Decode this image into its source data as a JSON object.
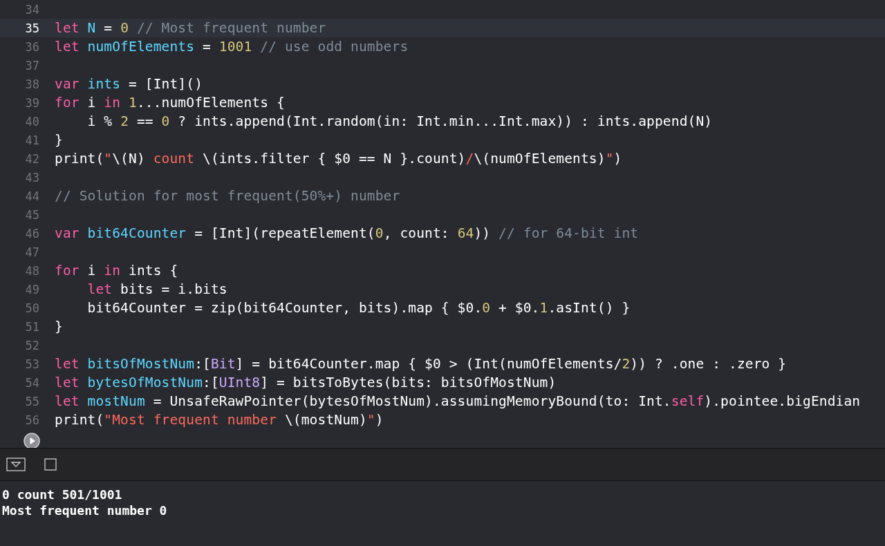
{
  "editor": {
    "lines": [
      {
        "number": "34",
        "selected": false
      },
      {
        "number": "35",
        "selected": true,
        "tokens": [
          {
            "kind": "kw",
            "text": "let "
          },
          {
            "kind": "ident",
            "text": "N"
          },
          {
            "kind": "plain",
            "text": " = "
          },
          {
            "kind": "num",
            "text": "0"
          },
          {
            "kind": "comment",
            "text": " // Most frequent number"
          }
        ]
      },
      {
        "number": "36",
        "selected": false,
        "tokens": [
          {
            "kind": "kw",
            "text": "let "
          },
          {
            "kind": "ident",
            "text": "numOfElements"
          },
          {
            "kind": "plain",
            "text": " = "
          },
          {
            "kind": "num",
            "text": "1001"
          },
          {
            "kind": "comment",
            "text": " // use odd numbers"
          }
        ]
      },
      {
        "number": "37",
        "selected": false
      },
      {
        "number": "38",
        "selected": false,
        "tokens": [
          {
            "kind": "kw",
            "text": "var "
          },
          {
            "kind": "ident",
            "text": "ints"
          },
          {
            "kind": "plain",
            "text": " = [Int]()"
          }
        ]
      },
      {
        "number": "39",
        "selected": false,
        "tokens": [
          {
            "kind": "kw",
            "text": "for"
          },
          {
            "kind": "plain",
            "text": " i "
          },
          {
            "kind": "kw",
            "text": "in "
          },
          {
            "kind": "num",
            "text": "1"
          },
          {
            "kind": "plain",
            "text": "...numOfElements {"
          }
        ]
      },
      {
        "number": "40",
        "selected": false,
        "tokens": [
          {
            "kind": "plain",
            "text": "    i % "
          },
          {
            "kind": "num",
            "text": "2"
          },
          {
            "kind": "plain",
            "text": " == "
          },
          {
            "kind": "num",
            "text": "0"
          },
          {
            "kind": "plain",
            "text": " ? ints.append(Int.random(in: Int.min...Int.max)) : ints.append(N)"
          }
        ]
      },
      {
        "number": "41",
        "selected": false,
        "tokens": [
          {
            "kind": "plain",
            "text": "}"
          }
        ]
      },
      {
        "number": "42",
        "selected": false,
        "tokens": [
          {
            "kind": "plain",
            "text": "print("
          },
          {
            "kind": "str",
            "text": "\""
          },
          {
            "kind": "plain",
            "text": "\\(N)"
          },
          {
            "kind": "str",
            "text": " count "
          },
          {
            "kind": "plain",
            "text": "\\(ints.filter { $0 == N }.count)"
          },
          {
            "kind": "str",
            "text": "/"
          },
          {
            "kind": "plain",
            "text": "\\(numOfElements)"
          },
          {
            "kind": "str",
            "text": "\""
          },
          {
            "kind": "plain",
            "text": ")"
          }
        ]
      },
      {
        "number": "43",
        "selected": false
      },
      {
        "number": "44",
        "selected": false,
        "tokens": [
          {
            "kind": "comment",
            "text": "// Solution for most frequent(50%+) number"
          }
        ]
      },
      {
        "number": "45",
        "selected": false
      },
      {
        "number": "46",
        "selected": false,
        "tokens": [
          {
            "kind": "kw",
            "text": "var "
          },
          {
            "kind": "ident",
            "text": "bit64Counter"
          },
          {
            "kind": "plain",
            "text": " = [Int](repeatElement("
          },
          {
            "kind": "num",
            "text": "0"
          },
          {
            "kind": "plain",
            "text": ", count: "
          },
          {
            "kind": "num",
            "text": "64"
          },
          {
            "kind": "plain",
            "text": ")) "
          },
          {
            "kind": "comment",
            "text": "// for 64-bit int"
          }
        ]
      },
      {
        "number": "47",
        "selected": false
      },
      {
        "number": "48",
        "selected": false,
        "tokens": [
          {
            "kind": "kw",
            "text": "for"
          },
          {
            "kind": "plain",
            "text": " i "
          },
          {
            "kind": "kw",
            "text": "in"
          },
          {
            "kind": "plain",
            "text": " ints {"
          }
        ]
      },
      {
        "number": "49",
        "selected": false,
        "tokens": [
          {
            "kind": "kw",
            "text": "    let"
          },
          {
            "kind": "plain",
            "text": " bits = i.bits"
          }
        ]
      },
      {
        "number": "50",
        "selected": false,
        "tokens": [
          {
            "kind": "plain",
            "text": "    bit64Counter = zip(bit64Counter, bits).map { $0."
          },
          {
            "kind": "num",
            "text": "0"
          },
          {
            "kind": "plain",
            "text": " + $0."
          },
          {
            "kind": "num",
            "text": "1"
          },
          {
            "kind": "plain",
            "text": ".asInt() }"
          }
        ]
      },
      {
        "number": "51",
        "selected": false,
        "tokens": [
          {
            "kind": "plain",
            "text": "}"
          }
        ]
      },
      {
        "number": "52",
        "selected": false
      },
      {
        "number": "53",
        "selected": false,
        "tokens": [
          {
            "kind": "kw",
            "text": "let "
          },
          {
            "kind": "ident",
            "text": "bitsOfMostNum"
          },
          {
            "kind": "plain",
            "text": ":["
          },
          {
            "kind": "type",
            "text": "Bit"
          },
          {
            "kind": "plain",
            "text": "] = bit64Counter.map { $0 > (Int(numOfElements/"
          },
          {
            "kind": "num",
            "text": "2"
          },
          {
            "kind": "plain",
            "text": ")) ? .one : .zero }"
          }
        ]
      },
      {
        "number": "54",
        "selected": false,
        "tokens": [
          {
            "kind": "kw",
            "text": "let "
          },
          {
            "kind": "ident",
            "text": "bytesOfMostNum"
          },
          {
            "kind": "plain",
            "text": ":["
          },
          {
            "kind": "type",
            "text": "UInt8"
          },
          {
            "kind": "plain",
            "text": "] = bitsToBytes(bits: bitsOfMostNum)"
          }
        ]
      },
      {
        "number": "55",
        "selected": false,
        "tokens": [
          {
            "kind": "kw",
            "text": "let "
          },
          {
            "kind": "ident",
            "text": "mostNum"
          },
          {
            "kind": "plain",
            "text": " = UnsafeRawPointer(bytesOfMostNum).assumingMemoryBound(to: Int."
          },
          {
            "kind": "kw",
            "text": "self"
          },
          {
            "kind": "plain",
            "text": ").pointee.bigEndian"
          }
        ]
      },
      {
        "number": "56",
        "selected": false,
        "tokens": [
          {
            "kind": "plain",
            "text": "print("
          },
          {
            "kind": "str",
            "text": "\"Most frequent number "
          },
          {
            "kind": "plain",
            "text": "\\(mostNum)"
          },
          {
            "kind": "str",
            "text": "\""
          },
          {
            "kind": "plain",
            "text": ")"
          }
        ]
      }
    ]
  },
  "console": {
    "output": [
      "0 count 501/1001",
      "Most frequent number 0"
    ]
  }
}
